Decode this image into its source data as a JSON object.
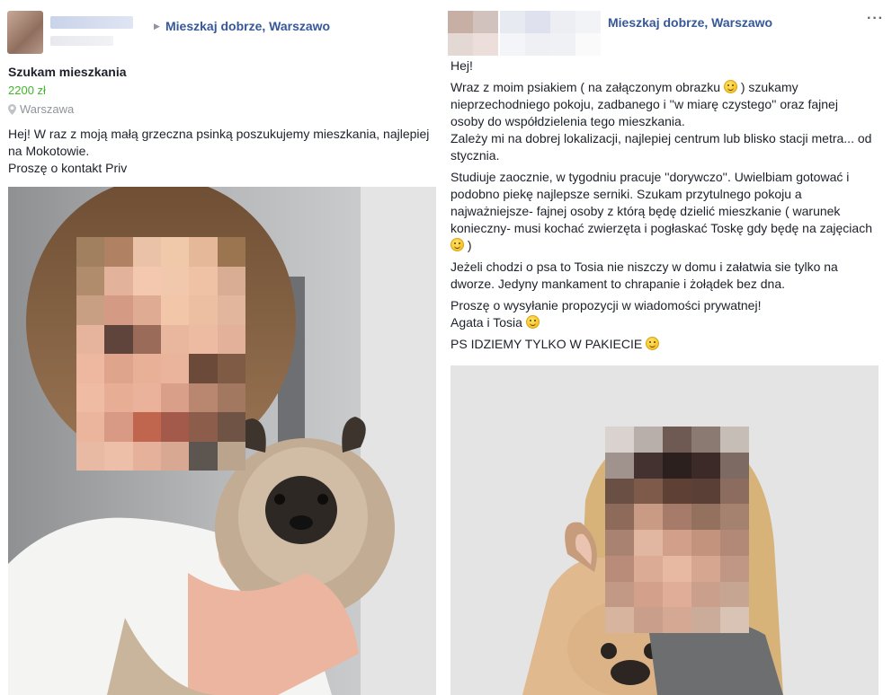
{
  "left_post": {
    "group_name": "Mieszkaj dobrze, Warszawo",
    "title": "Szukam mieszkania",
    "price": "2200 zł",
    "location": "Warszawa",
    "body_line1": "Hej! W raz z moją małą grzeczna psinką poszukujemy mieszkania, najlepiej na Mokotowie.",
    "body_line2": "Proszę o kontakt Priv",
    "photo_icon": "photo-woman-with-pug"
  },
  "right_post": {
    "group_name": "Mieszkaj dobrze, Warszawo",
    "more_label": "···",
    "p1": "Hej!",
    "p2a": "Wraz z moim psiakiem ( na załączonym obrazku ",
    "p2b": " ) szukamy nieprzechodniego pokoju, zadbanego i ''w miarę czystego'' oraz fajnej osoby do współdzielenia tego mieszkania.",
    "p2c": "Zależy mi na dobrej lokalizacji, najlepiej centrum lub blisko stacji metra... od stycznia.",
    "p3a": "Studiuje zaocznie, w tygodniu pracuje ''dorywczo''. Uwielbiam gotować i podobno piekę najlepsze serniki. Szukam przytulnego pokoju a najważniejsze- fajnej osoby z którą będę dzielić mieszkanie ( warunek konieczny- musi kochać zwierzęta i pogłaskać Toskę gdy będę na zajęciach ",
    "p3b": " )",
    "p4": "Jeżeli chodzi o psa to Tosia nie niszczy w domu i załatwia sie tylko na dworze. Jedyny mankament to chrapanie i żołądek bez dna.",
    "p5": "Proszę o wysyłanie propozycji w wiadomości prywatnej!",
    "p6": "Agata i Tosia ",
    "p7": "PS IDZIEMY TYLKO W PAKIECIE ",
    "photo_icon": "photo-woman-with-french-bulldog"
  }
}
